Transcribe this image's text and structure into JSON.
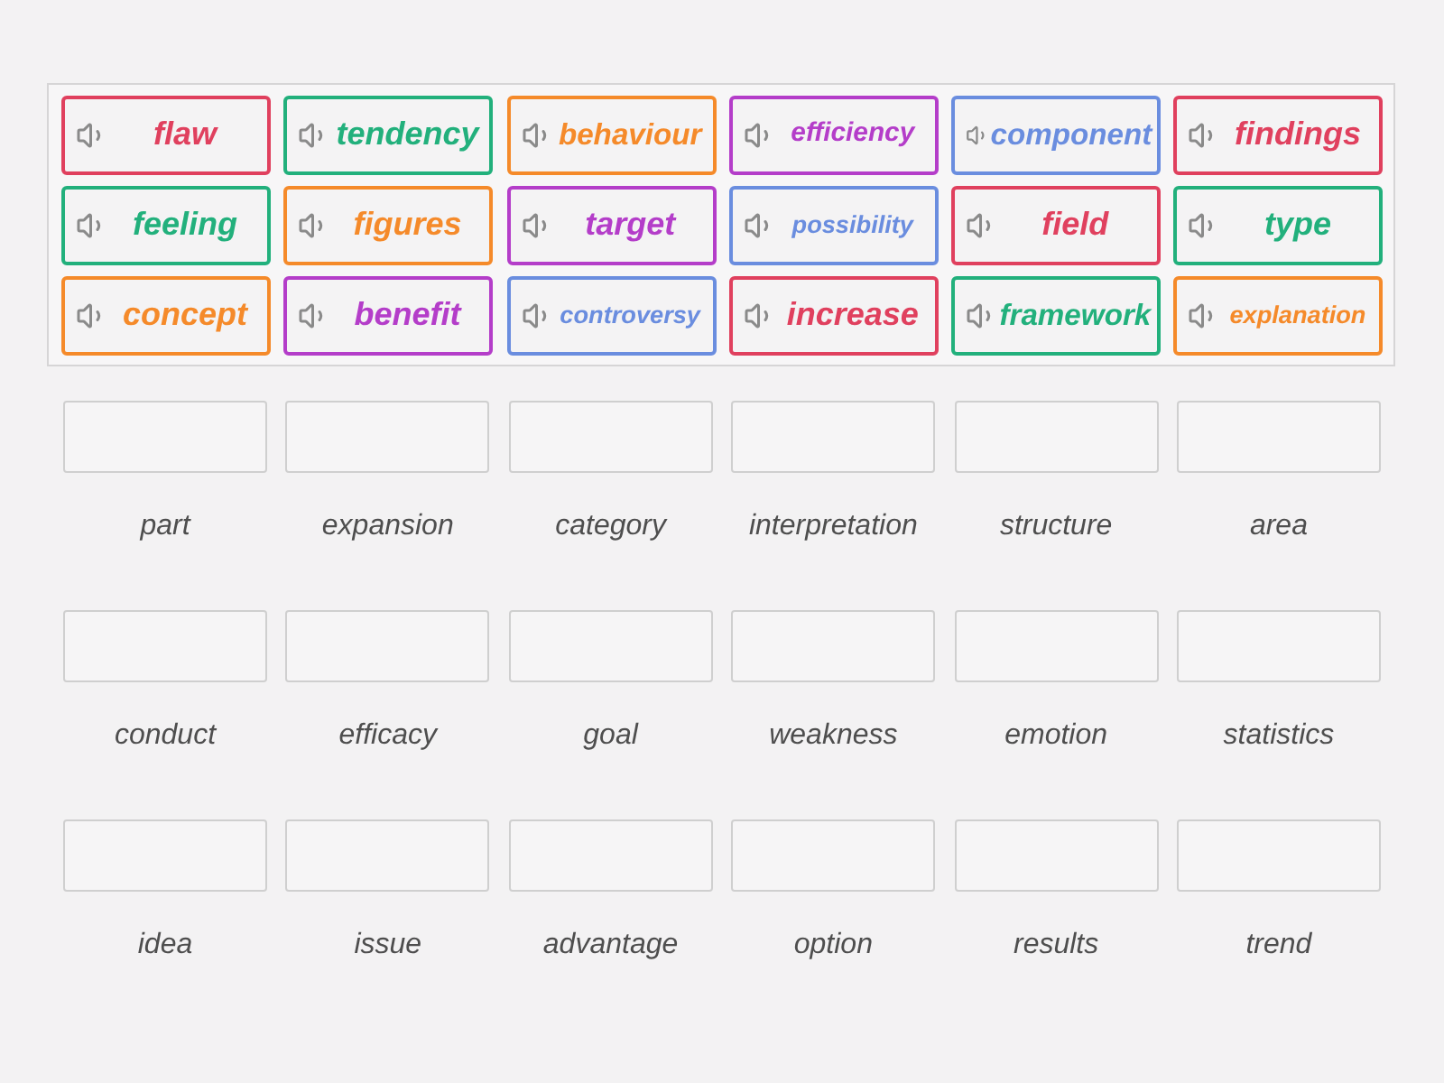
{
  "word_bank": {
    "tiles": [
      {
        "word": "flaw",
        "color": "#e0405e"
      },
      {
        "word": "tendency",
        "color": "#22b07c"
      },
      {
        "word": "behaviour",
        "color": "#f58a2a"
      },
      {
        "word": "efficiency",
        "color": "#b43dc9"
      },
      {
        "word": "component",
        "color": "#6a8ddf"
      },
      {
        "word": "findings",
        "color": "#e0405e"
      },
      {
        "word": "feeling",
        "color": "#22b07c"
      },
      {
        "word": "figures",
        "color": "#f58a2a"
      },
      {
        "word": "target",
        "color": "#b43dc9"
      },
      {
        "word": "possibility",
        "color": "#6a8ddf"
      },
      {
        "word": "field",
        "color": "#e0405e"
      },
      {
        "word": "type",
        "color": "#22b07c"
      },
      {
        "word": "concept",
        "color": "#f58a2a"
      },
      {
        "word": "benefit",
        "color": "#b43dc9"
      },
      {
        "word": "controversy",
        "color": "#6a8ddf"
      },
      {
        "word": "increase",
        "color": "#e0405e"
      },
      {
        "word": "framework",
        "color": "#22b07c"
      },
      {
        "word": "explanation",
        "color": "#f58a2a"
      }
    ]
  },
  "answer_grid": [
    {
      "label": "part"
    },
    {
      "label": "expansion"
    },
    {
      "label": "category"
    },
    {
      "label": "interpretation"
    },
    {
      "label": "structure"
    },
    {
      "label": "area"
    },
    {
      "label": "conduct"
    },
    {
      "label": "efficacy"
    },
    {
      "label": "goal"
    },
    {
      "label": "weakness"
    },
    {
      "label": "emotion"
    },
    {
      "label": "statistics"
    },
    {
      "label": "idea"
    },
    {
      "label": "issue"
    },
    {
      "label": "advantage"
    },
    {
      "label": "option"
    },
    {
      "label": "results"
    },
    {
      "label": "trend"
    }
  ]
}
